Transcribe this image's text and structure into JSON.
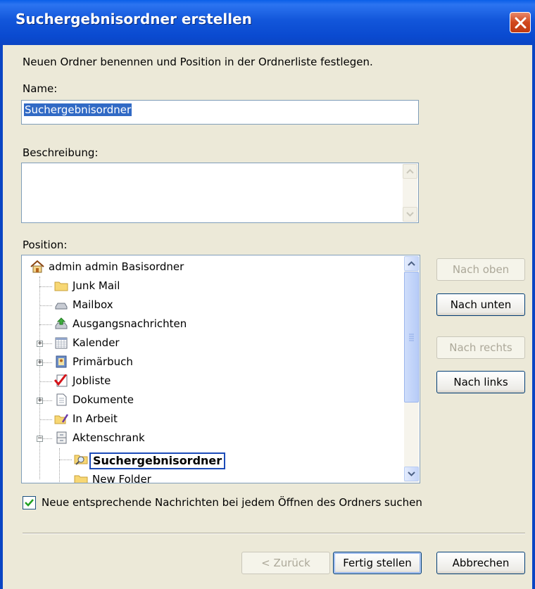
{
  "window": {
    "title": "Suchergebnisordner erstellen",
    "close": "close"
  },
  "intro": "Neuen Ordner benennen und Position in der Ordnerliste festlegen.",
  "name_field": {
    "label": "Name:",
    "value": "Suchergebnisordner"
  },
  "description_field": {
    "label": "Beschreibung:",
    "value": ""
  },
  "position": {
    "label": "Position:",
    "tree": [
      {
        "label": "admin admin Basisordner",
        "icon": "home-icon"
      },
      {
        "label": "Junk Mail",
        "icon": "folder-icon"
      },
      {
        "label": "Mailbox",
        "icon": "mailbox-icon"
      },
      {
        "label": "Ausgangsnachrichten",
        "icon": "outbox-icon"
      },
      {
        "label": "Kalender",
        "icon": "calendar-icon",
        "expandable": true
      },
      {
        "label": "Primärbuch",
        "icon": "address-book-icon",
        "expandable": true
      },
      {
        "label": "Jobliste",
        "icon": "checklist-icon"
      },
      {
        "label": "Dokumente",
        "icon": "documents-icon",
        "expandable": true
      },
      {
        "label": "In Arbeit",
        "icon": "work-in-progress-icon"
      },
      {
        "label": "Aktenschrank",
        "icon": "cabinet-icon",
        "expanded": true
      },
      {
        "label": "Suchergebnisordner",
        "icon": "search-folder-icon",
        "editing": true
      },
      {
        "label": "New Folder",
        "icon": "folder-icon"
      }
    ]
  },
  "move_buttons": {
    "up": "Nach oben",
    "down": "Nach unten",
    "right": "Nach rechts",
    "left": "Nach links"
  },
  "search_checkbox": {
    "label": "Neue entsprechende Nachrichten bei jedem Öffnen des Ordners suchen",
    "checked": true
  },
  "footer": {
    "back": "< Zurück",
    "finish": "Fertig stellen",
    "cancel": "Abbrechen"
  },
  "colors": {
    "title_bar": "#0A4AD0",
    "selection": "#316AC5",
    "dialog_bg": "#ECE9D8"
  }
}
